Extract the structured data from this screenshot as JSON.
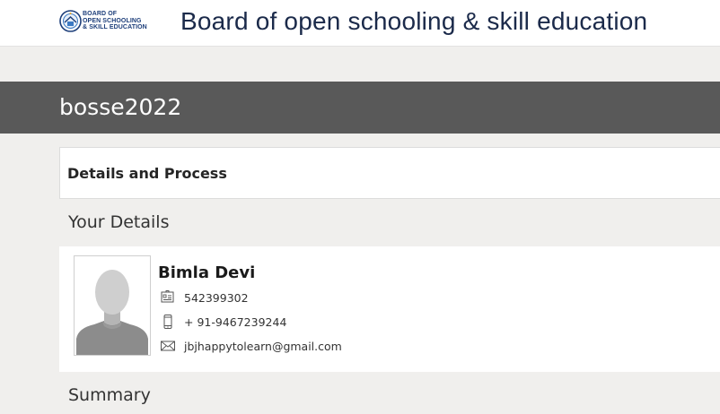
{
  "header": {
    "logo_text": [
      "BOARD OF",
      "OPEN SCHOOLING",
      "& SKILL EDUCATION"
    ],
    "site_title": "Board of open schooling & skill education",
    "brand_color": "#1d3e7a"
  },
  "banner": {
    "title": "bosse2022",
    "background": "#595959"
  },
  "details_card": {
    "title": "Details and Process"
  },
  "sections": {
    "your_details": "Your Details",
    "summary": "Summary"
  },
  "profile": {
    "name": "Bimla Devi",
    "id_number": "542399302",
    "phone": "+ 91-9467239244",
    "email": "jbjhappytolearn@gmail.com",
    "icons": {
      "id": "id-card-icon",
      "phone": "mobile-phone-icon",
      "email": "envelope-icon"
    }
  }
}
